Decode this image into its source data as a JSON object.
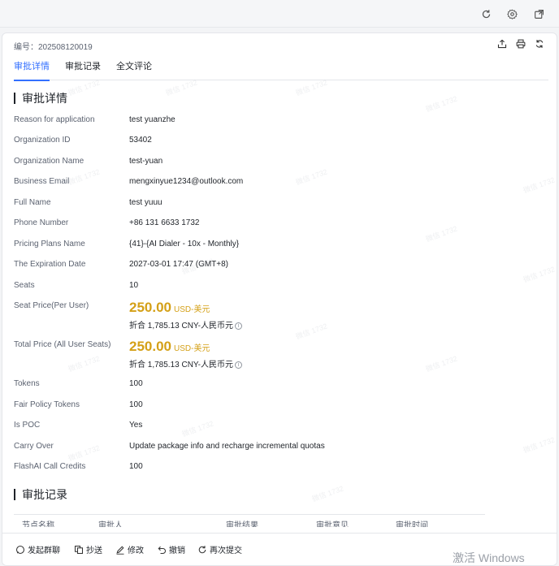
{
  "toolbar": {
    "icons": [
      "refresh-icon",
      "settings-icon",
      "external-window-icon"
    ]
  },
  "header": {
    "ticket_label": "编号：",
    "ticket_number": "202508120019",
    "icons": [
      "share-icon",
      "print-icon",
      "sync-icon"
    ]
  },
  "tabs": [
    {
      "label": "审批详情",
      "active": true
    },
    {
      "label": "审批记录",
      "active": false
    },
    {
      "label": "全文评论",
      "active": false
    }
  ],
  "details": {
    "section_title": "审批详情",
    "fields": [
      {
        "label": "Reason for application",
        "value": "test yuanzhe"
      },
      {
        "label": "Organization ID",
        "value": "53402"
      },
      {
        "label": "Organization Name",
        "value": "test-yuan"
      },
      {
        "label": "Business Email",
        "value": "mengxinyue1234@outlook.com"
      },
      {
        "label": "Full Name",
        "value": "test yuuu"
      },
      {
        "label": "Phone Number",
        "value": "+86 131 6633 1732"
      },
      {
        "label": "Pricing Plans Name",
        "value": "{41}-{AI Dialer - 10x - Monthly}"
      },
      {
        "label": "The Expiration Date",
        "value": "2027-03-01 17:47 (GMT+8)"
      },
      {
        "label": "Seats",
        "value": "10"
      }
    ],
    "seat_price": {
      "label": "Seat Price(Per User)",
      "amount": "250.00",
      "currency": "USD-美元",
      "converted": "折合 1,785.13 CNY-人民币元"
    },
    "total_price": {
      "label": "Total Price (All User Seats)",
      "amount": "250.00",
      "currency": "USD-美元",
      "converted": "折合 1,785.13 CNY-人民币元"
    },
    "fields_after": [
      {
        "label": "Tokens",
        "value": "100"
      },
      {
        "label": "Fair Policy Tokens",
        "value": "100"
      },
      {
        "label": "Is POC",
        "value": "Yes"
      },
      {
        "label": "Carry Over",
        "value": "Update package info and recharge incremental quotas"
      },
      {
        "label": "FlashAI Call Credits",
        "value": "100"
      }
    ]
  },
  "records": {
    "section_title": "审批记录",
    "columns": [
      "节点名称",
      "审批人",
      "审批结果",
      "审批意见",
      "审批时间"
    ]
  },
  "actions": [
    {
      "label": "发起群聊",
      "icon": "group-chat-icon"
    },
    {
      "label": "抄送",
      "icon": "cc-icon"
    },
    {
      "label": "修改",
      "icon": "edit-icon"
    },
    {
      "label": "撤销",
      "icon": "undo-icon"
    },
    {
      "label": "再次提交",
      "icon": "resubmit-icon"
    }
  ],
  "system": {
    "activation_text": "激活 Windows"
  },
  "watermark_text": "微信 1732"
}
